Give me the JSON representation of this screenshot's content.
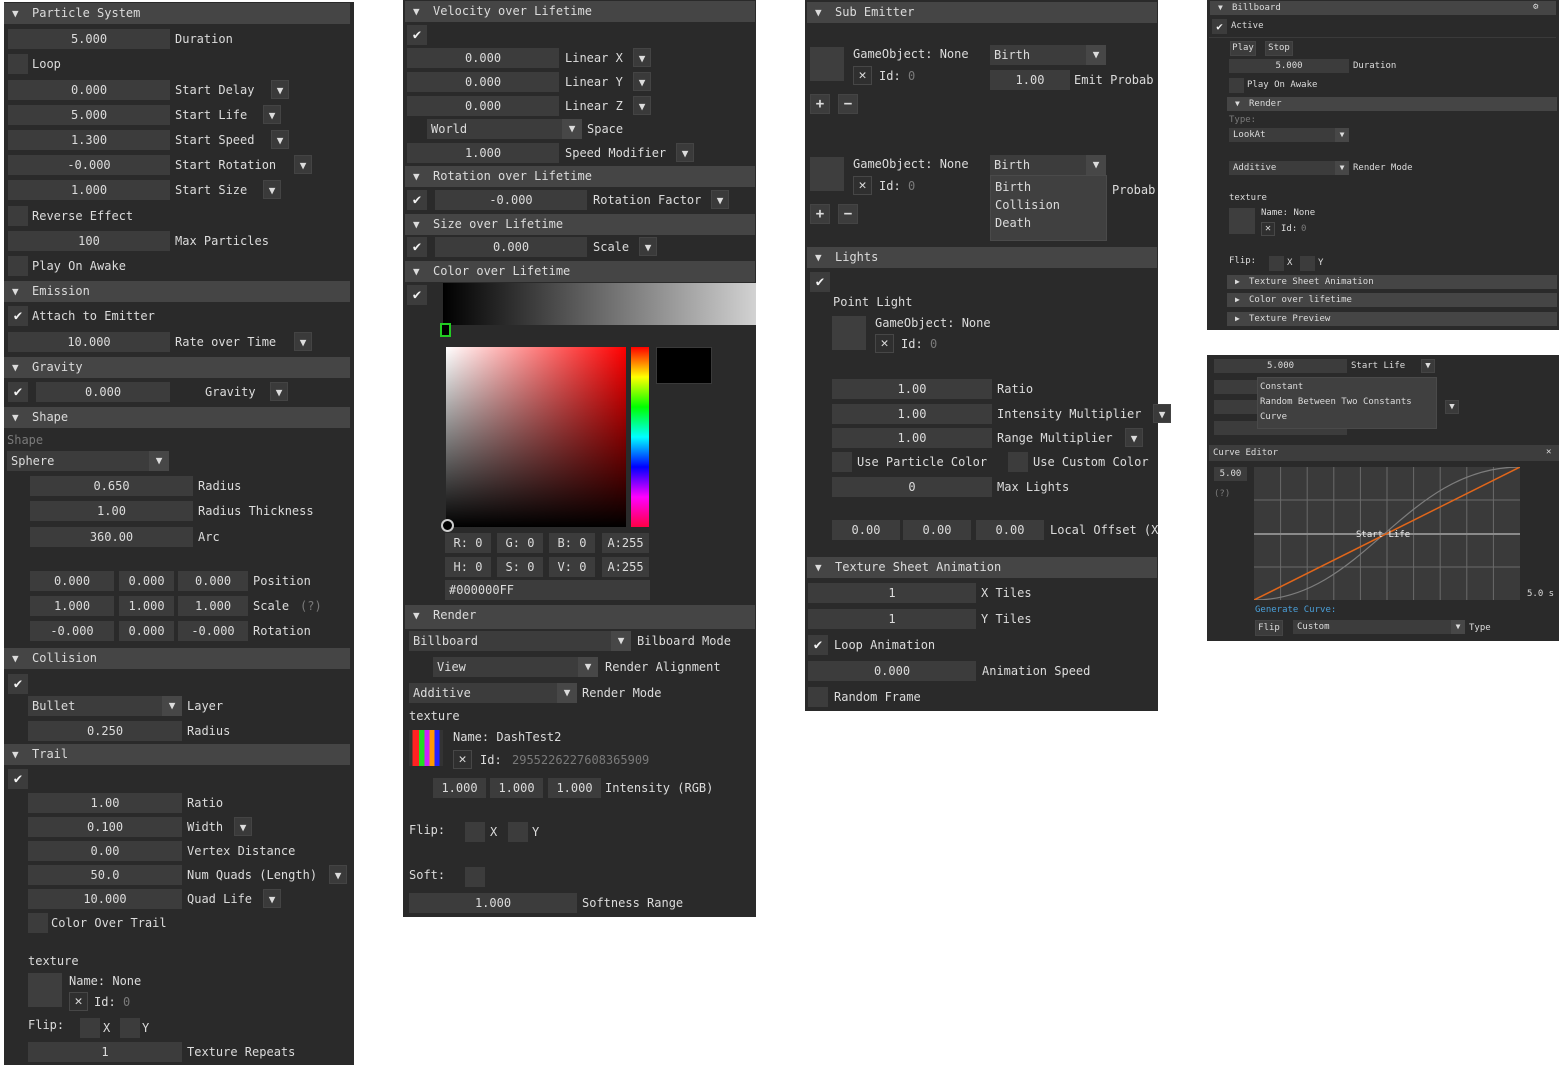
{
  "colors": {
    "panel_bg": "#2a2a2a",
    "header_bg": "#454545",
    "frame_bg": "#3c3c3c",
    "text": "#dcdcdc",
    "curve_orange": "#e0661b",
    "generate_blue": "#4a9fd8",
    "gradient_marker": "#22cc22"
  },
  "p1": {
    "title": "Particle System",
    "duration": "5.000",
    "duration_label": "Duration",
    "loop_label": "Loop",
    "start_delay": "0.000",
    "start_delay_label": "Start Delay",
    "start_life": "5.000",
    "start_life_label": "Start Life",
    "start_speed": "1.300",
    "start_speed_label": "Start Speed",
    "start_rotation": "-0.000",
    "start_rotation_label": "Start Rotation",
    "start_size": "1.000",
    "start_size_label": "Start Size",
    "reverse_effect_label": "Reverse Effect",
    "max_particles": "100",
    "max_particles_label": "Max Particles",
    "play_on_awake_label": "Play On Awake",
    "emission_title": "Emission",
    "attach_label": "Attach to Emitter",
    "rate": "10.000",
    "rate_label": "Rate over Time",
    "gravity_title": "Gravity",
    "gravity": "0.000",
    "gravity_label": "Gravity",
    "shape_title": "Shape",
    "shape_label": "Shape",
    "shape_type": "Sphere",
    "radius": "0.650",
    "radius_label": "Radius",
    "radius_thickness": "1.00",
    "radius_thickness_label": "Radius Thickness",
    "arc": "360.00",
    "arc_label": "Arc",
    "position": [
      "0.000",
      "0.000",
      "0.000"
    ],
    "position_label": "Position",
    "scale": [
      "1.000",
      "1.000",
      "1.000"
    ],
    "scale_label": "Scale",
    "scale_help": "(?)",
    "rotation": [
      "-0.000",
      "0.000",
      "-0.000"
    ],
    "rotation_label": "Rotation",
    "collision_title": "Collision",
    "layer": "Bullet",
    "layer_label": "Layer",
    "col_radius": "0.250",
    "col_radius_label": "Radius",
    "trail_title": "Trail",
    "ratio": "1.00",
    "ratio_label": "Ratio",
    "width": "0.100",
    "width_label": "Width",
    "vertex_distance": "0.00",
    "vertex_distance_label": "Vertex Distance",
    "num_quads": "50.0",
    "num_quads_label": "Num Quads (Length)",
    "quad_life": "10.000",
    "quad_life_label": "Quad Life",
    "color_over_trail_label": "Color Over Trail",
    "texture_label": "texture",
    "tex_name": "Name: None",
    "tex_id_label": "Id:",
    "tex_id": "0",
    "flip_label": "Flip:",
    "flip_x": "X",
    "flip_y": "Y",
    "texture_repeats": "1",
    "texture_repeats_label": "Texture Repeats",
    "checks": {
      "loop": false,
      "reverse_effect": false,
      "play_on_awake": false,
      "attach": true,
      "gravity": true,
      "collision": true,
      "trail": true,
      "color_over_trail": false,
      "flip_x": false,
      "flip_y": false
    }
  },
  "p2": {
    "velocity_title": "Velocity over Lifetime",
    "linear_x": "0.000",
    "linear_x_label": "Linear X",
    "linear_y": "0.000",
    "linear_y_label": "Linear Y",
    "linear_z": "0.000",
    "linear_z_label": "Linear Z",
    "space": "World",
    "space_label": "Space",
    "speed_modifier": "1.000",
    "speed_modifier_label": "Speed Modifier",
    "rotation_title": "Rotation over Lifetime",
    "rotation_factor": "-0.000",
    "rotation_factor_label": "Rotation Factor",
    "size_title": "Size over Lifetime",
    "scale": "0.000",
    "scale_label": "Scale",
    "color_title": "Color over Lifetime",
    "rgba": [
      "R:  0",
      "G:  0",
      "B:  0",
      "A:255"
    ],
    "hsva": [
      "H:  0",
      "S:  0",
      "V:  0",
      "A:255"
    ],
    "hex": "#000000FF",
    "render_title": "Render",
    "billboard_mode": "Billboard",
    "billboard_mode_label": "Bilboard Mode",
    "render_alignment": "View",
    "render_alignment_label": "Render Alignment",
    "render_mode": "Additive",
    "render_mode_label": "Render Mode",
    "texture_label": "texture",
    "tex_name": "Name: DashTest2",
    "tex_id_label": "Id:",
    "tex_id": "2955226227608365909",
    "intensity": [
      "1.000",
      "1.000",
      "1.000"
    ],
    "intensity_label": "Intensity (RGB)",
    "flip_label": "Flip:",
    "flip_x": "X",
    "flip_y": "Y",
    "soft_label": "Soft:",
    "softness_range": "1.000",
    "softness_range_label": "Softness Range",
    "checks": {
      "velocity": true,
      "rotation": true,
      "size": true,
      "color": true,
      "flip_x": false,
      "flip_y": false,
      "soft": false
    }
  },
  "p3": {
    "sub_emitter_title": "Sub Emitter",
    "go_label_1": "GameObject: None",
    "id_label_1": "Id:",
    "id_1": "0",
    "event_1": "Birth",
    "probability_1": "1.00",
    "probability_label_1": "Emit Probab",
    "go_label_2": "GameObject: None",
    "id_label_2": "Id:",
    "id_2": "0",
    "event_2": "Birth",
    "probability_label_2": "Probab",
    "event_options": [
      "Birth",
      "Collision",
      "Death"
    ],
    "add": "+",
    "remove": "−",
    "lights_title": "Lights",
    "point_light_label": "Point Light",
    "light_go": "GameObject: None",
    "light_id_label": "Id:",
    "light_id": "0",
    "ratio": "1.00",
    "ratio_label": "Ratio",
    "intensity_multiplier": "1.00",
    "intensity_multiplier_label": "Intensity Multiplier",
    "range_multiplier": "1.00",
    "range_multiplier_label": "Range Multiplier",
    "use_particle_color_label": "Use Particle Color",
    "use_custom_color_label": "Use Custom Color",
    "max_lights": "0",
    "max_lights_label": "Max Lights",
    "local_offset": [
      "0.00",
      "0.00",
      "0.00"
    ],
    "local_offset_label": "Local Offset (X",
    "tsa_title": "Texture Sheet Animation",
    "x_tiles": "1",
    "x_tiles_label": "X Tiles",
    "y_tiles": "1",
    "y_tiles_label": "Y Tiles",
    "loop_animation_label": "Loop Animation",
    "animation_speed": "0.000",
    "animation_speed_label": "Animation Speed",
    "random_frame_label": "Random Frame",
    "checks": {
      "lights": true,
      "use_particle_color": false,
      "use_custom_color": false,
      "loop_animation": true,
      "random_frame": false
    }
  },
  "p4": {
    "title": "Billboard",
    "active_label": "Active",
    "play": "Play",
    "stop": "Stop",
    "duration": "5.000",
    "duration_label": "Duration",
    "play_on_awake_label": "Play On Awake",
    "render_title": "Render",
    "type_label": "Type:",
    "type": "LookAt",
    "render_mode": "Additive",
    "render_mode_label": "Render Mode",
    "texture_label": "texture",
    "tex_name": "Name: None",
    "tex_id_label": "Id:",
    "tex_id": "0",
    "flip_label": "Flip:",
    "flip_x": "X",
    "flip_y": "Y",
    "tsa_title": "Texture Sheet Animation",
    "col_title": "Color over lifetime",
    "preview_title": "Texture Preview",
    "checks": {
      "active": true,
      "play_on_awake": false,
      "flip_x": false,
      "flip_y": false
    }
  },
  "p5": {
    "start_life": "5.000",
    "start_life_label": "Start Life",
    "mode_options": [
      "Constant",
      "Random Between Two Constants",
      "Curve"
    ],
    "curve_editor_title": "Curve Editor",
    "close": "✕",
    "max_value": "5.00",
    "help": "(?)",
    "curve_label": "Start Life",
    "time_label": "5.0 s",
    "generate_label": "Generate Curve:",
    "flip": "Flip",
    "curve_type": "Custom",
    "type_label": "Type"
  }
}
